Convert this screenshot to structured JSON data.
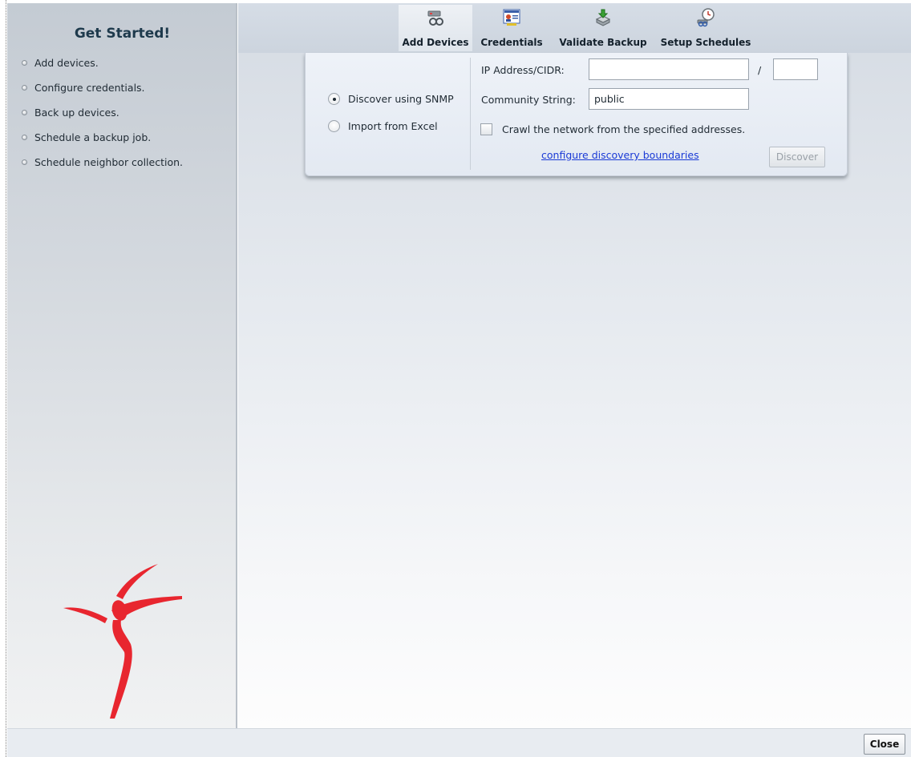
{
  "sidebar": {
    "title": "Get Started!",
    "steps": [
      "Add devices.",
      "Configure credentials.",
      "Back up devices.",
      "Schedule a backup job.",
      "Schedule neighbor collection."
    ],
    "logo_color": "#e8262f"
  },
  "tabs": [
    {
      "label": "Add Devices",
      "icon": "add-devices-icon",
      "active": true
    },
    {
      "label": "Credentials",
      "icon": "credentials-icon",
      "active": false
    },
    {
      "label": "Validate Backup",
      "icon": "validate-backup-icon",
      "active": false
    },
    {
      "label": "Setup Schedules",
      "icon": "setup-schedules-icon",
      "active": false
    }
  ],
  "panel": {
    "discover_snmp": {
      "label": "Discover using SNMP",
      "selected": true
    },
    "import_excel": {
      "label": "Import from Excel",
      "selected": false
    },
    "ip_label": "IP Address/CIDR:",
    "ip_value": "",
    "cidr_separator": "/",
    "cidr_value": "",
    "community_label": "Community String:",
    "community_value": "public",
    "crawl_label": "Crawl the network from the specified addresses.",
    "crawl_checked": false,
    "boundaries_link": "configure discovery boundaries",
    "discover_button": "Discover"
  },
  "footer": {
    "close_button": "Close"
  }
}
